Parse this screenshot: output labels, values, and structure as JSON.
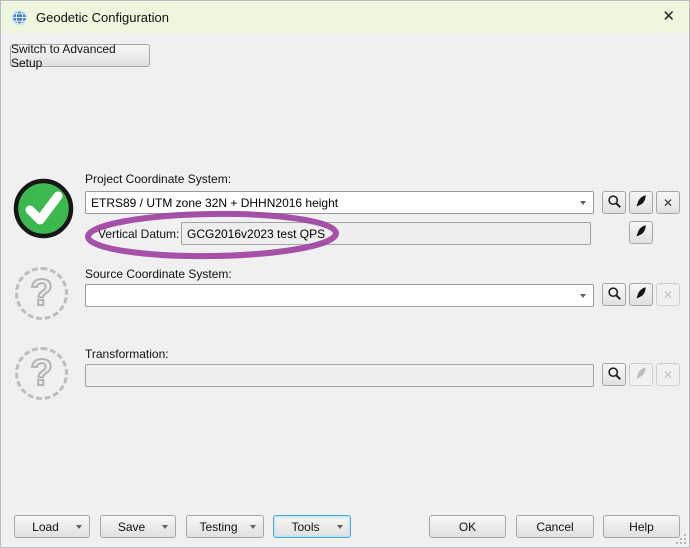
{
  "window": {
    "title": "Geodetic Configuration"
  },
  "icons": {
    "close_glyph": "✕",
    "clear_glyph": "✕",
    "question_glyph": "?"
  },
  "toolbar": {
    "switch_button": "Switch to Advanced Setup"
  },
  "project": {
    "label": "Project Coordinate System:",
    "value": "ETRS89 / UTM zone 32N + DHHN2016 height",
    "vertical_datum_label": "Vertical Datum:",
    "vertical_datum_value": "GCG2016v2023 test QPS"
  },
  "source": {
    "label": "Source Coordinate System:",
    "value": ""
  },
  "transformation": {
    "label": "Transformation:",
    "value": ""
  },
  "footer": {
    "load": "Load",
    "save": "Save",
    "testing": "Testing",
    "tools": "Tools",
    "ok": "OK",
    "cancel": "Cancel",
    "help": "Help"
  },
  "colors": {
    "titlebar_bg": "#eff6de",
    "status_ok_green": "#3cb94e",
    "annotation_purple": "#9c3f9e",
    "focus_blue": "#43a9e0"
  }
}
